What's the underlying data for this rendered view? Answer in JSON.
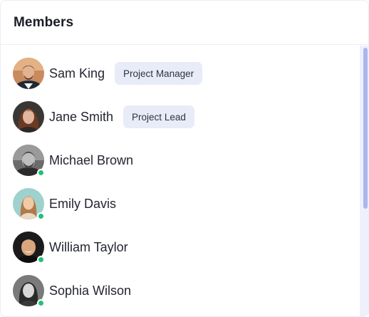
{
  "header": {
    "title": "Members"
  },
  "colors": {
    "online": "#22c07a",
    "badge_bg": "#e8ecf8",
    "scroll_thumb": "#aab6ee",
    "scroll_track": "#eef1fb"
  },
  "members": [
    {
      "name": "Sam King",
      "role": "Project Manager",
      "online": false,
      "avatar": "avatar-sam"
    },
    {
      "name": "Jane Smith",
      "role": "Project Lead",
      "online": false,
      "avatar": "avatar-jane"
    },
    {
      "name": "Michael Brown",
      "role": "",
      "online": true,
      "avatar": "avatar-michael"
    },
    {
      "name": "Emily Davis",
      "role": "",
      "online": true,
      "avatar": "avatar-emily"
    },
    {
      "name": "William Taylor",
      "role": "",
      "online": true,
      "avatar": "avatar-william"
    },
    {
      "name": "Sophia Wilson",
      "role": "",
      "online": true,
      "avatar": "avatar-sophia"
    }
  ]
}
